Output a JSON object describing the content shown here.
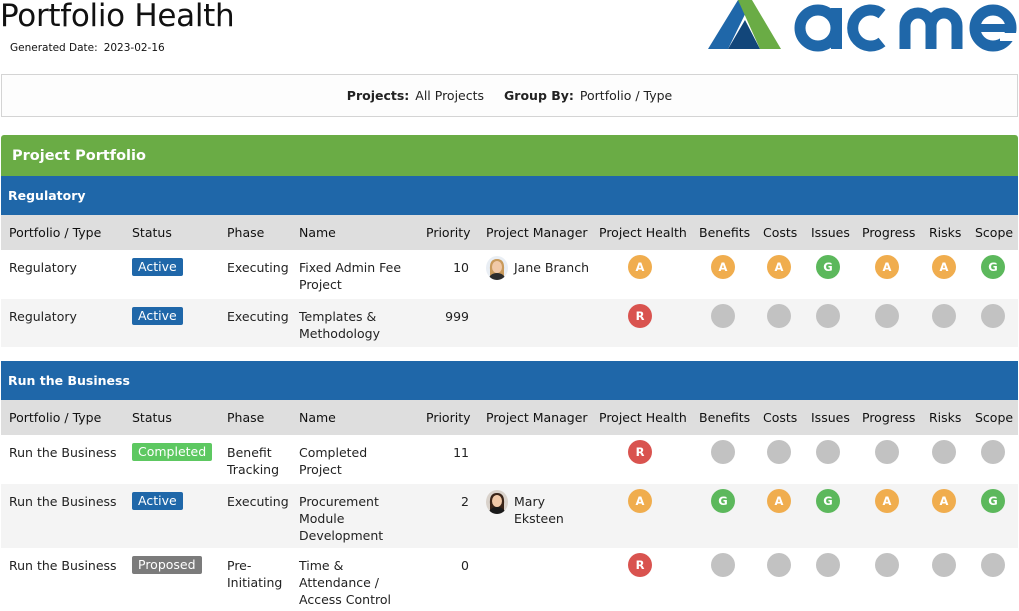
{
  "header": {
    "title": "Portfolio Health",
    "generated_label": "Generated Date:",
    "generated_value": "2023-02-16",
    "logo_text": "acme"
  },
  "filters": {
    "projects_label": "Projects:",
    "projects_value": "All Projects",
    "group_label": "Group By:",
    "group_value": "Portfolio / Type"
  },
  "portfolio_title": "Project Portfolio",
  "columns": [
    "Portfolio / Type",
    "Status",
    "Phase",
    "Name",
    "Priority",
    "Project Manager",
    "Project Health",
    "Benefits",
    "Costs",
    "Issues",
    "Progress",
    "Risks",
    "Scope"
  ],
  "groups": [
    {
      "name": "Regulatory",
      "rows": [
        {
          "type": "Regulatory",
          "status": "Active",
          "status_kind": "active",
          "phase": [
            "Executing"
          ],
          "name": [
            "Fixed Admin Fee",
            "Project"
          ],
          "priority": "10",
          "pm": [
            "Jane Branch"
          ],
          "avatar": "female-blonde",
          "health": [
            "A",
            "A",
            "A",
            "G",
            "A",
            "A",
            "G"
          ]
        },
        {
          "type": "Regulatory",
          "status": "Active",
          "status_kind": "active",
          "phase": [
            "Executing"
          ],
          "name": [
            "Templates &",
            "Methodology"
          ],
          "priority": "999",
          "pm": [],
          "avatar": "",
          "health": [
            "R",
            "",
            "",
            "",
            "",
            "",
            ""
          ]
        }
      ]
    },
    {
      "name": "Run the Business",
      "rows": [
        {
          "type": "Run the Business",
          "status": "Completed",
          "status_kind": "completed",
          "phase": [
            "Benefit",
            "Tracking"
          ],
          "name": [
            "Completed",
            "Project"
          ],
          "priority": "11",
          "pm": [],
          "avatar": "",
          "health": [
            "R",
            "",
            "",
            "",
            "",
            "",
            ""
          ]
        },
        {
          "type": "Run the Business",
          "status": "Active",
          "status_kind": "active",
          "phase": [
            "Executing"
          ],
          "name": [
            "Procurement",
            "Module",
            "Development"
          ],
          "priority": "2",
          "pm": [
            "Mary",
            "Eksteen"
          ],
          "avatar": "female-dark",
          "health": [
            "A",
            "G",
            "A",
            "G",
            "A",
            "A",
            "G"
          ]
        },
        {
          "type": "Run the Business",
          "status": "Proposed",
          "status_kind": "proposed",
          "phase": [
            "Pre-",
            "Initiating"
          ],
          "name": [
            "Time &",
            "Attendance /",
            "Access Control"
          ],
          "priority": "0",
          "pm": [],
          "avatar": "",
          "health": [
            "R",
            "",
            "",
            "",
            "",
            "",
            ""
          ]
        }
      ]
    }
  ],
  "colors": {
    "portfolio_green": "#6aac45",
    "group_blue": "#1f67a9",
    "red": "#d9534f",
    "amber": "#f0ad4e",
    "green": "#5cb85c",
    "grey": "#c2c2c2"
  }
}
